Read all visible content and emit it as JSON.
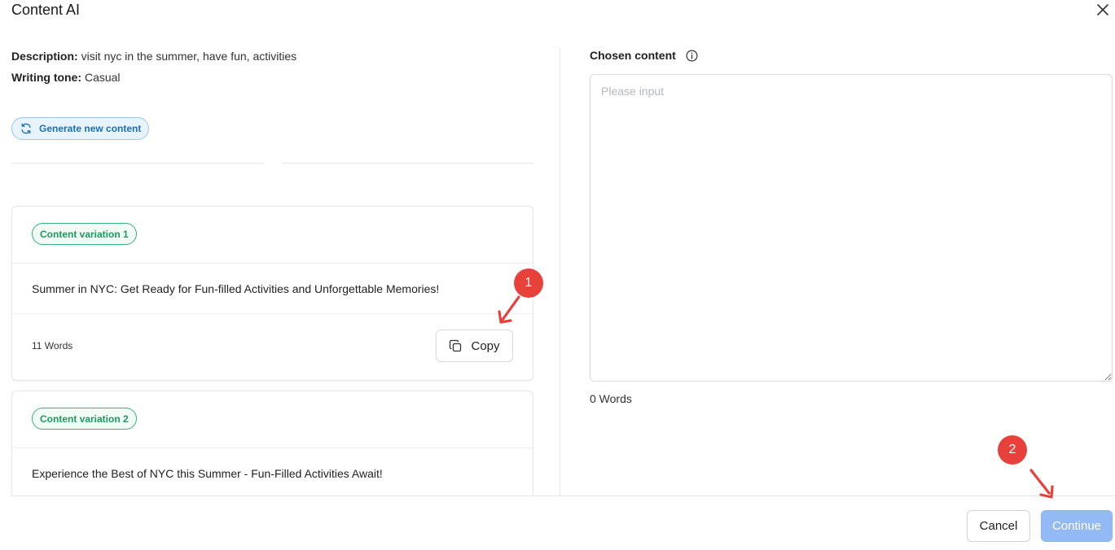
{
  "modal": {
    "title": "Content AI"
  },
  "left": {
    "description_label": "Description:",
    "description_value": "visit nyc in the summer, have fun, activities",
    "tone_label": "Writing tone:",
    "tone_value": "Casual",
    "generate_label": "Generate new content"
  },
  "variations": [
    {
      "badge": "Content variation 1",
      "text": "Summer in NYC: Get Ready for Fun-filled Activities and Unforgettable Memories!",
      "word_count": "11 Words",
      "copy_label": "Copy"
    },
    {
      "badge": "Content variation 2",
      "text": "Experience the Best of NYC this Summer - Fun-Filled Activities Await!"
    }
  ],
  "right": {
    "label": "Chosen content",
    "placeholder": "Please input",
    "word_count": "0 Words"
  },
  "footer": {
    "cancel_label": "Cancel",
    "continue_label": "Continue"
  },
  "annotations": {
    "step1": "1",
    "step2": "2"
  },
  "colors": {
    "accent_blue": "#1f6fb2",
    "badge_green": "#1d9a5f",
    "continue_disabled": "#94baf5",
    "annotation_red": "#e8403a"
  }
}
